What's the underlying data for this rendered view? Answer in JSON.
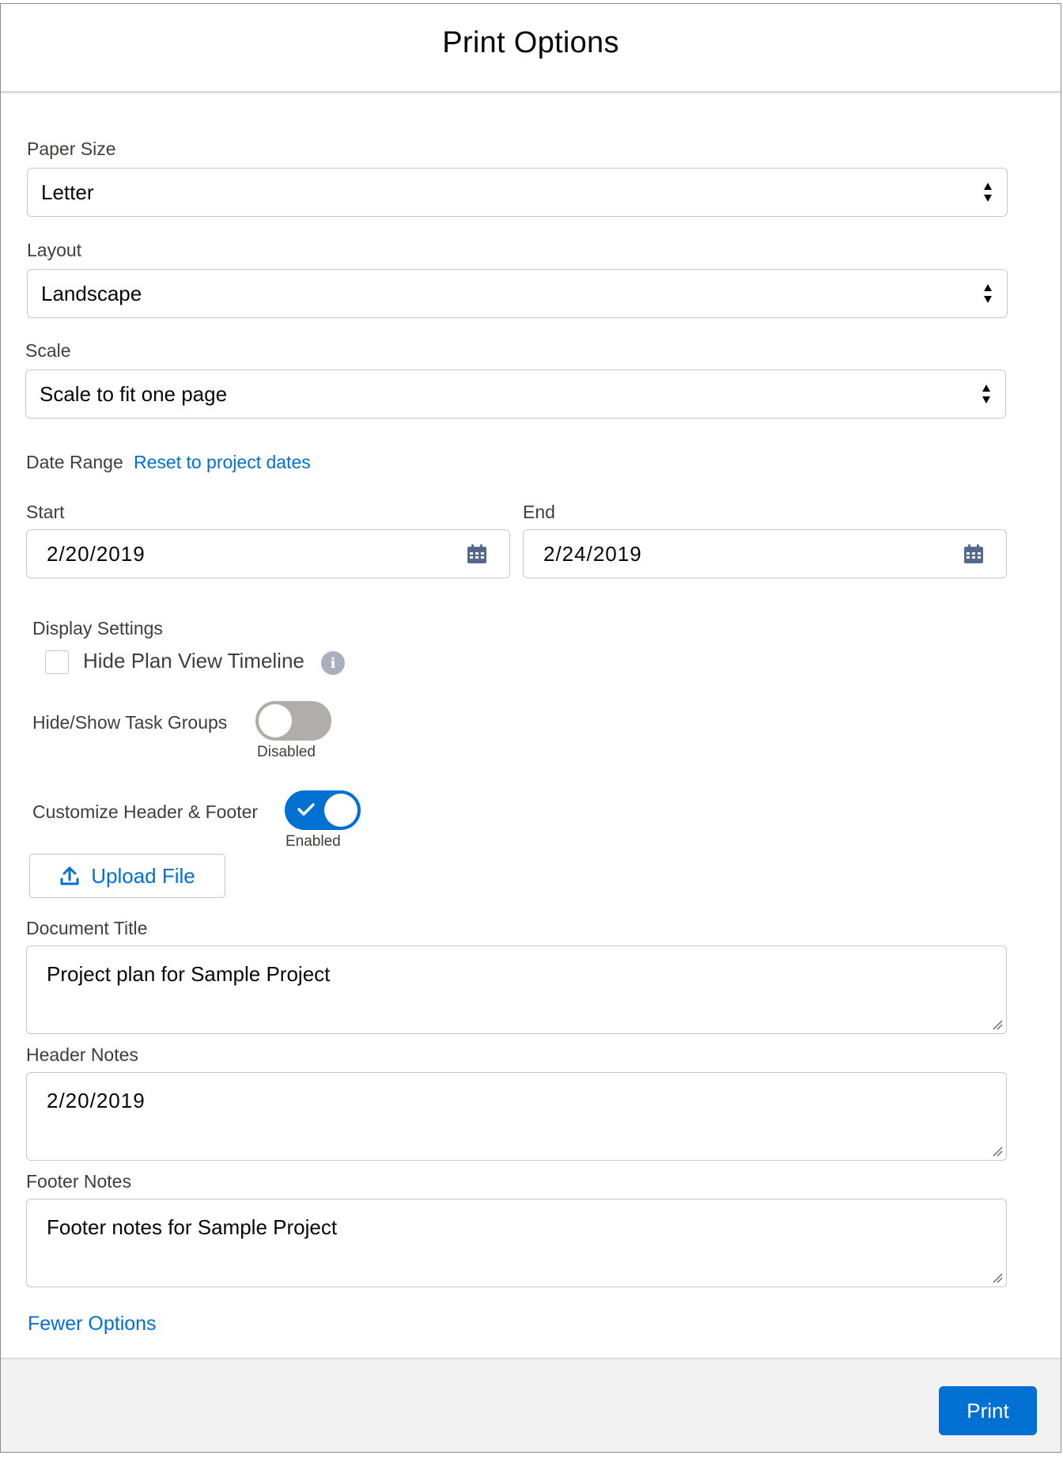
{
  "modal": {
    "title": "Print Options"
  },
  "paper_size": {
    "label": "Paper Size",
    "value": "Letter"
  },
  "layout": {
    "label": "Layout",
    "value": "Landscape"
  },
  "scale": {
    "label": "Scale",
    "value": "Scale to fit one page"
  },
  "date_range": {
    "label": "Date Range",
    "reset_link": "Reset to project dates",
    "start_label": "Start",
    "start_value": "2/20/2019",
    "end_label": "End",
    "end_value": "2/24/2019"
  },
  "display_settings": {
    "label": "Display Settings",
    "hide_timeline_label": "Hide Plan View Timeline",
    "hide_timeline_checked": false
  },
  "task_groups": {
    "label": "Hide/Show Task Groups",
    "state": "Disabled",
    "on": false
  },
  "header_footer": {
    "label": "Customize Header & Footer",
    "state": "Enabled",
    "on": true
  },
  "upload": {
    "label": "Upload File"
  },
  "document_title": {
    "label": "Document Title",
    "value": "Project plan for Sample Project"
  },
  "header_notes": {
    "label": "Header Notes",
    "value": "2/20/2019"
  },
  "footer_notes": {
    "label": "Footer Notes",
    "value": "Footer notes for Sample Project"
  },
  "fewer_options": "Fewer Options",
  "footer": {
    "print_label": "Print"
  },
  "colors": {
    "brand": "#0070d2",
    "toggle_off": "#b0adab",
    "footer_bg": "#f3f2f2"
  }
}
